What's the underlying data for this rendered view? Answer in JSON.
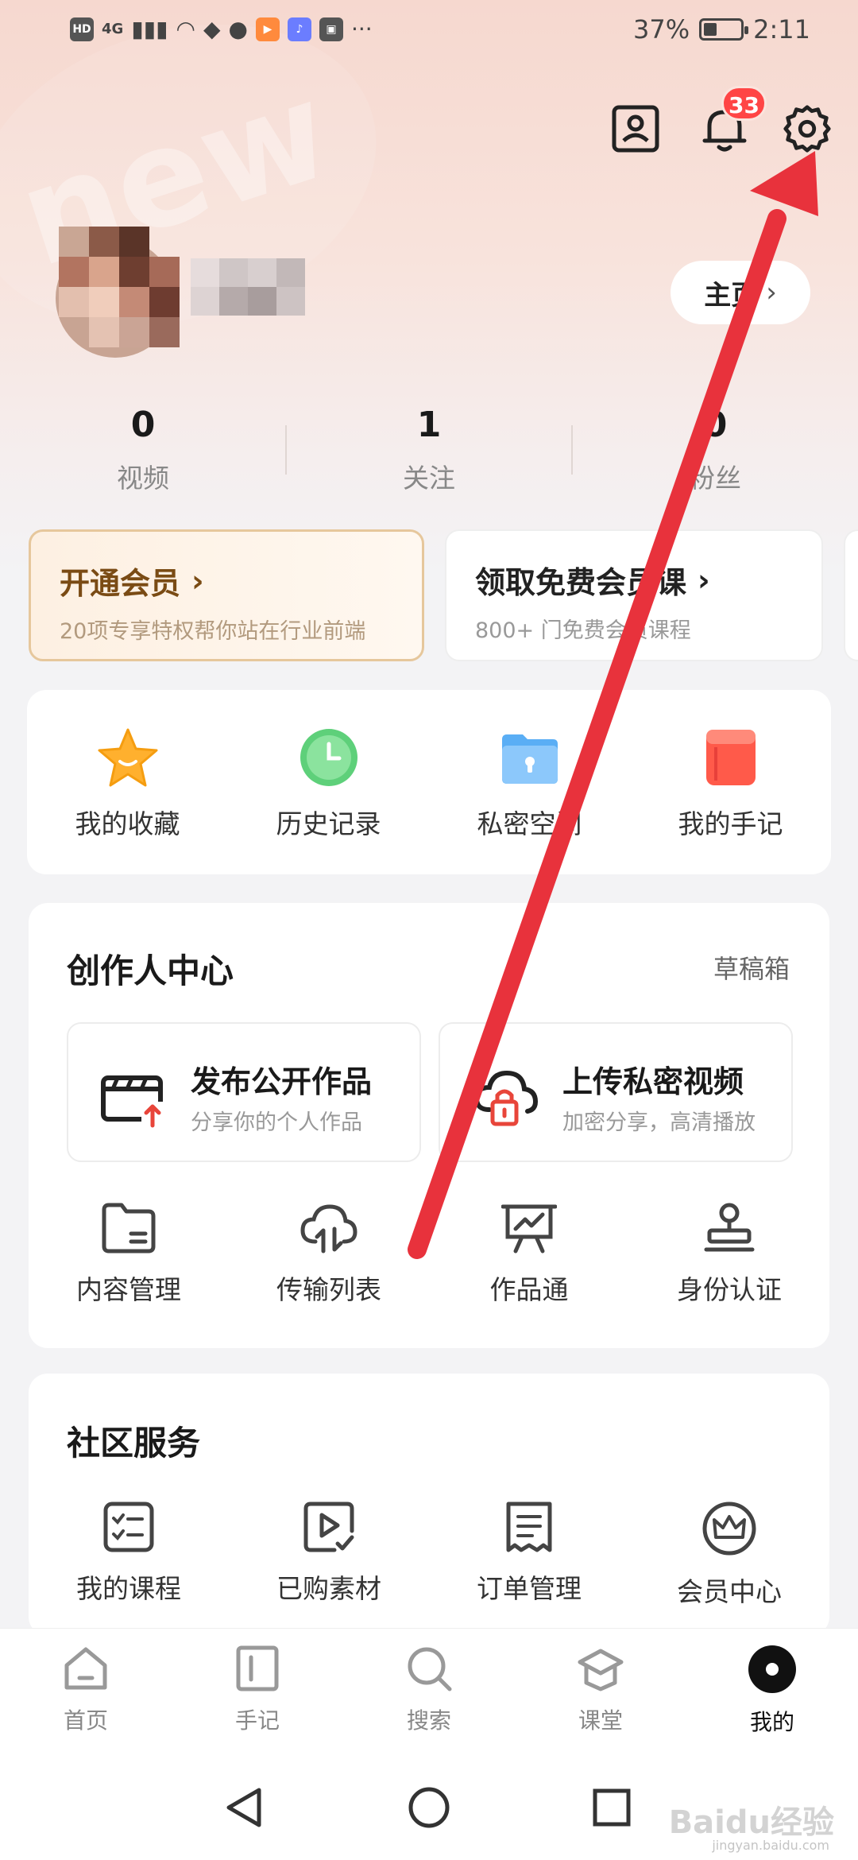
{
  "status_bar": {
    "hd": "HD",
    "network": "4G",
    "battery_text": "37%",
    "battery_level": 0.37,
    "time": "2:11",
    "more": "···"
  },
  "header": {
    "notification_count": "33",
    "watermark": "new"
  },
  "profile": {
    "home_label": "主页"
  },
  "stats": [
    {
      "num": "0",
      "label": "视频"
    },
    {
      "num": "1",
      "label": "关注"
    },
    {
      "num": "0",
      "label": "粉丝"
    }
  ],
  "promos": {
    "vip_title": "开通会员",
    "vip_sub": "20项专享特权帮你站在行业前端",
    "course_title": "领取免费会员课",
    "course_sub": "800+ 门免费会员课程"
  },
  "quick_access": [
    {
      "label": "我的收藏",
      "icon": "star-icon",
      "color": "#ffb02e"
    },
    {
      "label": "历史记录",
      "icon": "clock-icon",
      "color": "#5ed07a"
    },
    {
      "label": "私密空间",
      "icon": "lock-folder-icon",
      "color": "#5aaef5"
    },
    {
      "label": "我的手记",
      "icon": "notebook-icon",
      "color": "#ff5a4a"
    }
  ],
  "creator": {
    "title": "创作人中心",
    "drafts": "草稿箱",
    "publish_title": "发布公开作品",
    "publish_sub": "分享你的个人作品",
    "upload_title": "上传私密视频",
    "upload_sub": "加密分享，高清播放",
    "tools": [
      {
        "label": "内容管理",
        "icon": "folder-icon"
      },
      {
        "label": "传输列表",
        "icon": "cloud-transfer-icon"
      },
      {
        "label": "作品通",
        "icon": "presentation-icon"
      },
      {
        "label": "身份认证",
        "icon": "stamp-icon"
      }
    ]
  },
  "community": {
    "title": "社区服务",
    "items": [
      {
        "label": "我的课程",
        "icon": "checklist-icon"
      },
      {
        "label": "已购素材",
        "icon": "purchased-video-icon"
      },
      {
        "label": "订单管理",
        "icon": "receipt-icon"
      },
      {
        "label": "会员中心",
        "icon": "crown-icon"
      }
    ]
  },
  "bottom_nav": [
    {
      "label": "首页",
      "icon": "home-icon"
    },
    {
      "label": "手记",
      "icon": "note-icon"
    },
    {
      "label": "搜索",
      "icon": "search-icon"
    },
    {
      "label": "课堂",
      "icon": "classroom-icon"
    },
    {
      "label": "我的",
      "icon": "profile-dot-icon",
      "active": true
    }
  ],
  "watermark": {
    "brand": "Baidu经验",
    "url": "jingyan.baidu.com"
  },
  "colors": {
    "accent_red": "#e8323c",
    "badge_red": "#ff4545",
    "vip_gold": "#7a4b14"
  }
}
